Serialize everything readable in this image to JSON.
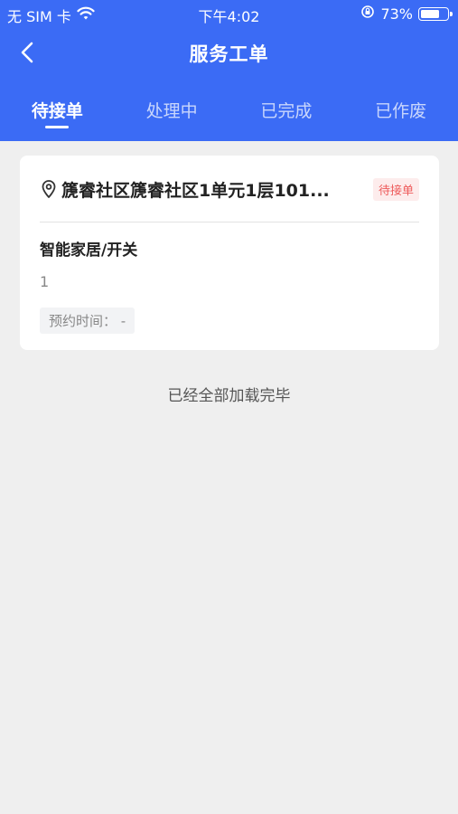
{
  "status_bar": {
    "carrier": "无 SIM 卡",
    "time": "下午4:02",
    "battery_percent": "73%",
    "battery_level": 0.73
  },
  "nav": {
    "title": "服务工单",
    "back_icon": "chevron-left-icon"
  },
  "tabs": [
    {
      "label": "待接单",
      "active": true
    },
    {
      "label": "处理中",
      "active": false
    },
    {
      "label": "已完成",
      "active": false
    },
    {
      "label": "已作废",
      "active": false
    }
  ],
  "order": {
    "location_icon": "location-pin-icon",
    "address": "篪睿社区篪睿社区1单元1层101...",
    "status": "待接单",
    "category": "智能家居/开关",
    "quantity": "1",
    "appointment_label": "预约时间：",
    "appointment_value": "-"
  },
  "list_end_text": "已经全部加载完毕",
  "colors": {
    "primary": "#3b6bf5",
    "background": "#efefef",
    "status_tag_text": "#ee5b5b",
    "status_tag_bg": "#fdecec"
  }
}
